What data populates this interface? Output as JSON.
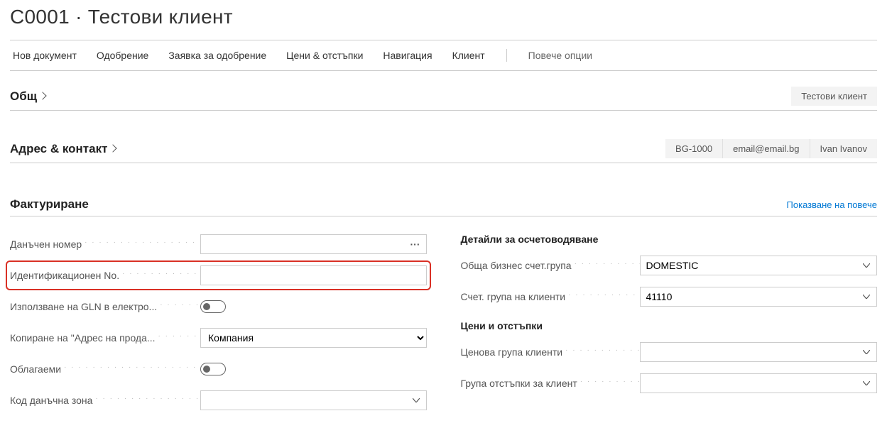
{
  "header": {
    "title": "C0001 · Тестови клиент"
  },
  "nav": {
    "items": [
      "Нов документ",
      "Одобрение",
      "Заявка за одобрение",
      "Цени & отстъпки",
      "Навигация",
      "Клиент"
    ],
    "more": "Повече опции"
  },
  "sections": {
    "general": {
      "title": "Общ",
      "badge": "Тестови клиент"
    },
    "address": {
      "title": "Адрес & контакт",
      "badges": [
        "BG-1000",
        "email@email.bg",
        "Ivan Ivanov"
      ]
    },
    "invoicing": {
      "title": "Фактуриране",
      "show_more": "Показване на повече",
      "fields": {
        "vat_no": {
          "label": "Данъчен номер",
          "value": ""
        },
        "id_no": {
          "label": "Идентификационен No.",
          "value": ""
        },
        "gln": {
          "label": "Използване на GLN в електро...",
          "value": false
        },
        "copy_sell_to": {
          "label": "Копиране на \"Адрес на прода...",
          "value": "Компания"
        },
        "taxable": {
          "label": "Облагаеми",
          "value": false
        },
        "tax_area": {
          "label": "Код данъчна зона",
          "value": ""
        }
      },
      "right": {
        "posting_header": "Детайли за осчетоводяване",
        "gen_bus_group": {
          "label": "Обща бизнес счет.група",
          "value": "DOMESTIC"
        },
        "cust_posting_group": {
          "label": "Счет. група на клиенти",
          "value": "41110"
        },
        "prices_header": "Цени и отстъпки",
        "price_group": {
          "label": "Ценова група клиенти",
          "value": ""
        },
        "disc_group": {
          "label": "Група отстъпки за клиент",
          "value": ""
        }
      }
    }
  }
}
